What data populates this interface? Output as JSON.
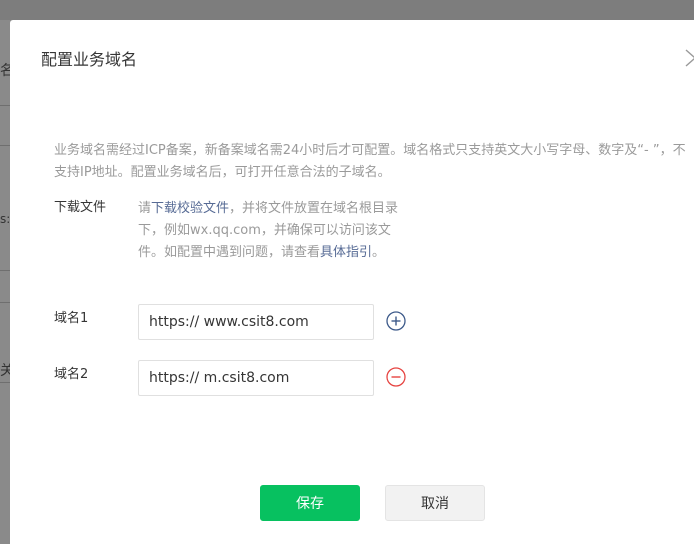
{
  "dialog": {
    "title": "配置业务域名",
    "close_icon": "chevron-right-icon"
  },
  "background": {
    "glyphs": [
      "名",
      "s:/",
      "关"
    ]
  },
  "description": "业务域名需经过ICP备案，新备案域名需24小时后才可配置。域名格式只支持英文大小写字母、数字及“- ”，不支持IP地址。配置业务域名后，可打开任意合法的子域名。",
  "download": {
    "label": "下载文件",
    "text_before": "请",
    "link_download": "下载校验文件",
    "text_middle": "，并将文件放置在域名根目录下，例如wx.qq.com，并确保可以访问该文件。如配置中遇到问题，请查看",
    "link_guide": "具体指引",
    "text_after": "。"
  },
  "domains": [
    {
      "label": "域名1",
      "value": "https:// www.csit8.com",
      "action": "add"
    },
    {
      "label": "域名2",
      "value": "https:// m.csit8.com",
      "action": "remove"
    }
  ],
  "buttons": {
    "save": "保存",
    "cancel": "取消"
  },
  "colors": {
    "primary_green": "#07c160",
    "link_blue": "#576b95",
    "add_icon_blue": "#3d5a8a",
    "remove_icon_red": "#e64340"
  }
}
